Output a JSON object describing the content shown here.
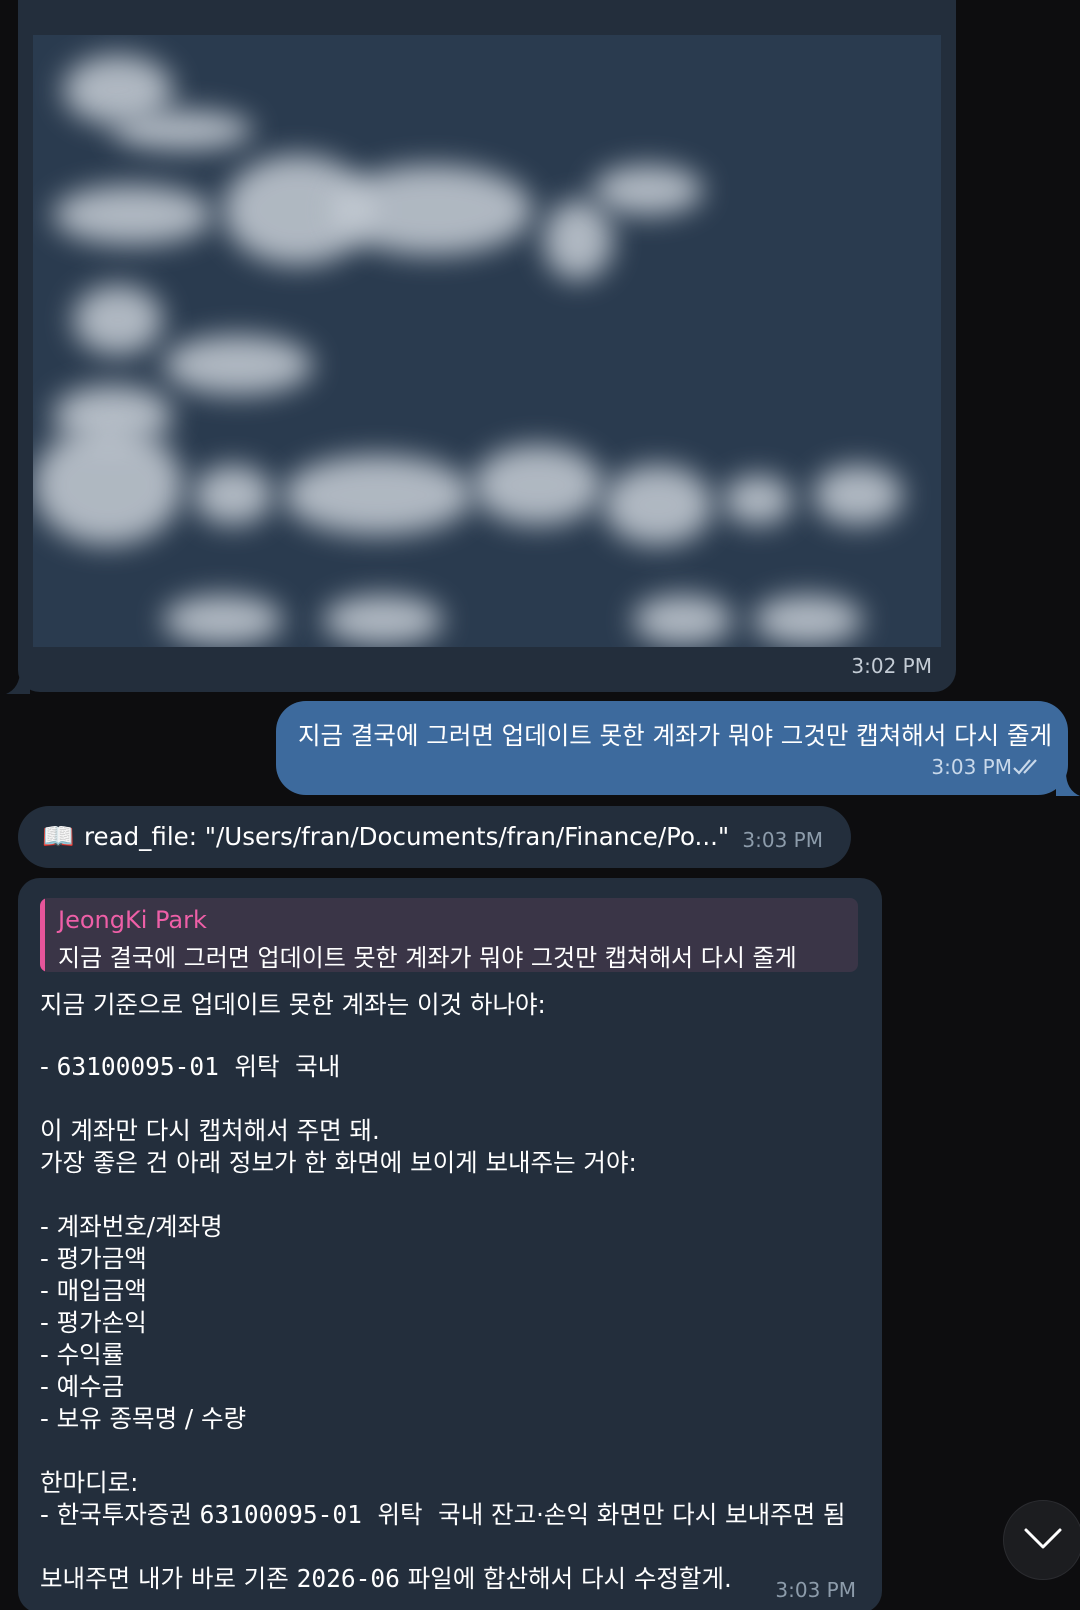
{
  "image_message": {
    "time": "3:02 PM"
  },
  "outgoing": {
    "text": "지금 결국에 그러면 업데이트 못한 계좌가 뭐야 그것만 캡쳐해서 다시 줄게",
    "time": "3:03 PM"
  },
  "tool_call": {
    "icon": "📖",
    "text": "read_file: \"/Users/fran/Documents/fran/Finance/Po...\"",
    "time": "3:03 PM"
  },
  "reply": {
    "quote_author": "JeongKi Park",
    "quote_text": "지금 결국에 그러면 업데이트 못한 계좌가 뭐야 그것만 캡쳐해서 다시 줄게",
    "lines": [
      "지금 기준으로 업데이트 못한 계좌는 이것 하나야:",
      "- ",
      "63100095-01",
      "위탁",
      "국내",
      "이 계좌만 다시 캡처해서 주면 돼.",
      "가장 좋은 건 아래 정보가 한 화면에 보이게 보내주는 거야:",
      "- 계좌번호/계좌명",
      "- 평가금액",
      "- 매입금액",
      "- 평가손익",
      "- 수익률",
      "- 예수금",
      "- 보유 종목명 / 수량",
      "한마디로:",
      "- 한국투자증권 ",
      "63100095-01",
      "위탁",
      "국내 잔고·손익 화면만 다시 보내주면 됨",
      "보내주면 내가 바로 기존 ",
      "2026-06",
      " 파일에 합산해서 다시 수정할게."
    ],
    "time": "3:03 PM"
  },
  "colors": {
    "background": "#0d0d0f",
    "incoming_bubble": "#232e3c",
    "outgoing_bubble": "#3d6a9d",
    "quote_accent": "#e6559a"
  }
}
